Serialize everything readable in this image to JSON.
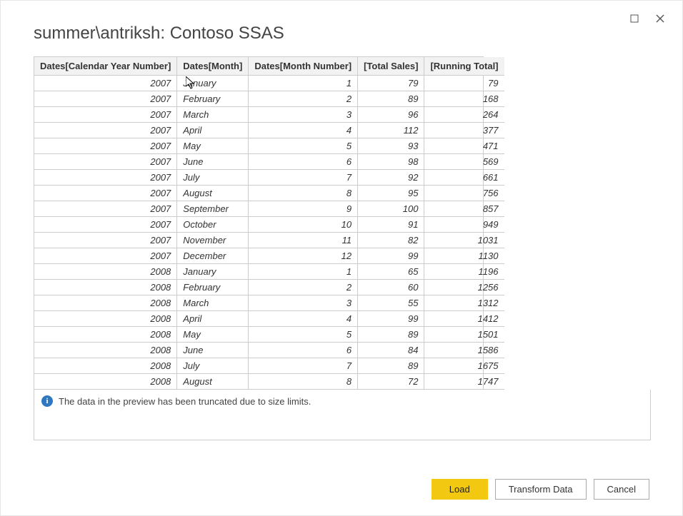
{
  "window": {
    "title": "summer\\antriksh: Contoso SSAS"
  },
  "table": {
    "columns": [
      "Dates[Calendar Year Number]",
      "Dates[Month]",
      "Dates[Month Number]",
      "[Total Sales]",
      "[Running Total]"
    ],
    "rows": [
      {
        "year": "2007",
        "month": "January",
        "monthNum": "1",
        "sales": "79",
        "running": "79"
      },
      {
        "year": "2007",
        "month": "February",
        "monthNum": "2",
        "sales": "89",
        "running": "168"
      },
      {
        "year": "2007",
        "month": "March",
        "monthNum": "3",
        "sales": "96",
        "running": "264"
      },
      {
        "year": "2007",
        "month": "April",
        "monthNum": "4",
        "sales": "112",
        "running": "377"
      },
      {
        "year": "2007",
        "month": "May",
        "monthNum": "5",
        "sales": "93",
        "running": "471"
      },
      {
        "year": "2007",
        "month": "June",
        "monthNum": "6",
        "sales": "98",
        "running": "569"
      },
      {
        "year": "2007",
        "month": "July",
        "monthNum": "7",
        "sales": "92",
        "running": "661"
      },
      {
        "year": "2007",
        "month": "August",
        "monthNum": "8",
        "sales": "95",
        "running": "756"
      },
      {
        "year": "2007",
        "month": "September",
        "monthNum": "9",
        "sales": "100",
        "running": "857"
      },
      {
        "year": "2007",
        "month": "October",
        "monthNum": "10",
        "sales": "91",
        "running": "949"
      },
      {
        "year": "2007",
        "month": "November",
        "monthNum": "11",
        "sales": "82",
        "running": "1031"
      },
      {
        "year": "2007",
        "month": "December",
        "monthNum": "12",
        "sales": "99",
        "running": "1130"
      },
      {
        "year": "2008",
        "month": "January",
        "monthNum": "1",
        "sales": "65",
        "running": "1196"
      },
      {
        "year": "2008",
        "month": "February",
        "monthNum": "2",
        "sales": "60",
        "running": "1256"
      },
      {
        "year": "2008",
        "month": "March",
        "monthNum": "3",
        "sales": "55",
        "running": "1312"
      },
      {
        "year": "2008",
        "month": "April",
        "monthNum": "4",
        "sales": "99",
        "running": "1412"
      },
      {
        "year": "2008",
        "month": "May",
        "monthNum": "5",
        "sales": "89",
        "running": "1501"
      },
      {
        "year": "2008",
        "month": "June",
        "monthNum": "6",
        "sales": "84",
        "running": "1586"
      },
      {
        "year": "2008",
        "month": "July",
        "monthNum": "7",
        "sales": "89",
        "running": "1675"
      },
      {
        "year": "2008",
        "month": "August",
        "monthNum": "8",
        "sales": "72",
        "running": "1747"
      }
    ]
  },
  "info": {
    "message": "The data in the preview has been truncated due to size limits."
  },
  "buttons": {
    "load": "Load",
    "transform": "Transform Data",
    "cancel": "Cancel"
  }
}
